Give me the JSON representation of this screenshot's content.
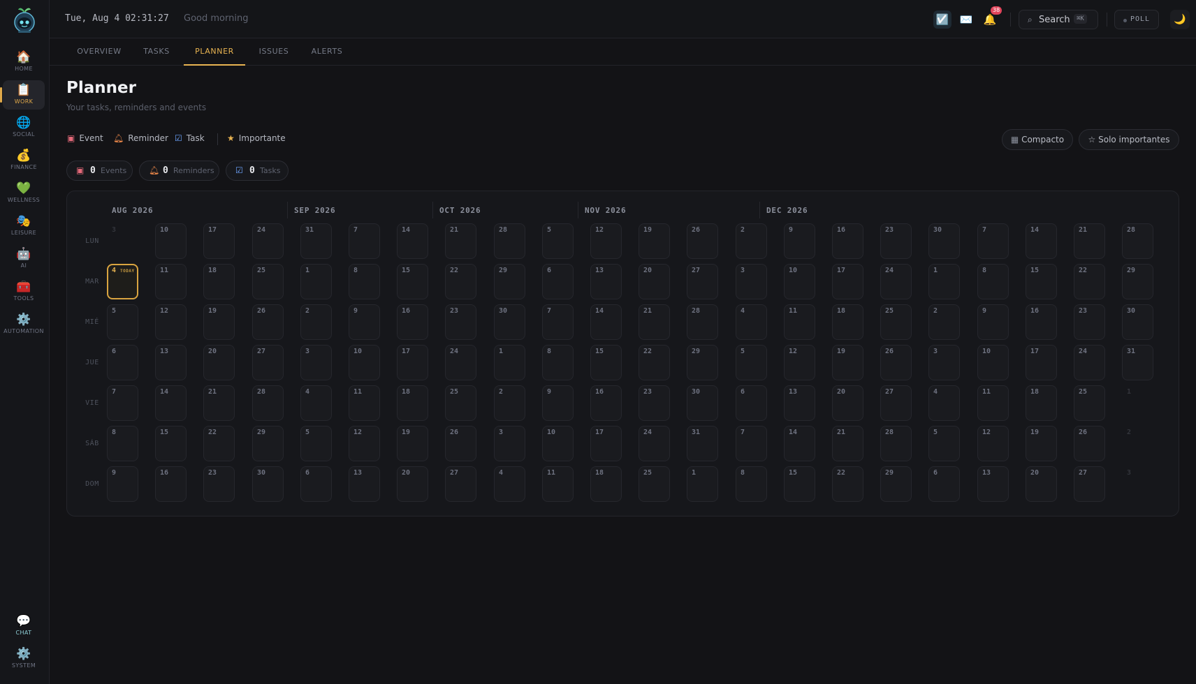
{
  "sidebar": {
    "items": [
      {
        "label": "HOME",
        "icon": "🏠",
        "icon_name": "house-icon"
      },
      {
        "label": "WORK",
        "icon": "📋",
        "icon_name": "clipboard-icon"
      },
      {
        "label": "SOCIAL",
        "icon": "🌐",
        "icon_name": "globe-icon"
      },
      {
        "label": "FINANCE",
        "icon": "💰",
        "icon_name": "money-bag-icon"
      },
      {
        "label": "WELLNESS",
        "icon": "💚",
        "icon_name": "green-heart-icon"
      },
      {
        "label": "LEISURE",
        "icon": "🎭",
        "icon_name": "theater-masks-icon"
      },
      {
        "label": "AI",
        "icon": "🤖",
        "icon_name": "robot-icon"
      },
      {
        "label": "TOOLS",
        "icon": "🧰",
        "icon_name": "toolbox-icon"
      },
      {
        "label": "AUTOMATION",
        "icon": "⚙️",
        "icon_name": "gear-icon"
      }
    ],
    "bottom_items": [
      {
        "label": "CHAT",
        "icon": "💬",
        "icon_name": "speech-bubble-icon"
      },
      {
        "label": "SYSTEM",
        "icon": "⚙️",
        "icon_name": "gear-icon"
      }
    ],
    "active": "WORK"
  },
  "header": {
    "datetime": "Tue, Aug 4 02:31:27",
    "greeting": "Good morning",
    "notifications_count": "38",
    "search_label": "Search",
    "search_shortcut": "⌘K",
    "poll_label": "POLL",
    "icons": {
      "tasks": "☑️",
      "mail": "✉️",
      "bell": "🔔",
      "search": "⌕",
      "theme": "🌙"
    }
  },
  "tabs": [
    "OVERVIEW",
    "TASKS",
    "PLANNER",
    "ISSUES",
    "ALERTS"
  ],
  "active_tab": "PLANNER",
  "page": {
    "title": "Planner",
    "subtitle": "Your tasks, reminders and events"
  },
  "legend": {
    "event": "Event",
    "reminder": "Reminder",
    "task": "Task",
    "important": "Importante"
  },
  "filters": {
    "compact": "Compacto",
    "only_important": "Solo importantes"
  },
  "counters": {
    "events": {
      "count": "0",
      "label": "Events"
    },
    "reminders": {
      "count": "0",
      "label": "Reminders"
    },
    "tasks": {
      "count": "0",
      "label": "Tasks"
    }
  },
  "calendar": {
    "months": [
      "AUG 2026",
      "SEP 2026",
      "OCT 2026",
      "NOV 2026",
      "DEC 2026"
    ],
    "weekdays": [
      "LUN",
      "MAR",
      "MIÉ",
      "JUE",
      "VIE",
      "SÁB",
      "DOM"
    ],
    "today_label": "TODAY",
    "weeks": [
      [
        "3",
        "4",
        "5",
        "6",
        "7",
        "8",
        "9"
      ],
      [
        "10",
        "11",
        "12",
        "13",
        "14",
        "15",
        "16"
      ],
      [
        "17",
        "18",
        "19",
        "20",
        "21",
        "22",
        "23"
      ],
      [
        "24",
        "25",
        "26",
        "27",
        "28",
        "29",
        "30"
      ],
      [
        "31",
        "1",
        "2",
        "3",
        "4",
        "5",
        "6"
      ],
      [
        "7",
        "8",
        "9",
        "10",
        "11",
        "12",
        "13"
      ],
      [
        "14",
        "15",
        "16",
        "17",
        "18",
        "19",
        "20"
      ],
      [
        "21",
        "22",
        "23",
        "24",
        "25",
        "26",
        "27"
      ],
      [
        "28",
        "29",
        "30",
        "1",
        "2",
        "3",
        "4"
      ],
      [
        "5",
        "6",
        "7",
        "8",
        "9",
        "10",
        "11"
      ],
      [
        "12",
        "13",
        "14",
        "15",
        "16",
        "17",
        "18"
      ],
      [
        "19",
        "20",
        "21",
        "22",
        "23",
        "24",
        "25"
      ],
      [
        "26",
        "27",
        "28",
        "29",
        "30",
        "31",
        "1"
      ],
      [
        "2",
        "3",
        "4",
        "5",
        "6",
        "7",
        "8"
      ],
      [
        "9",
        "10",
        "11",
        "12",
        "13",
        "14",
        "15"
      ],
      [
        "16",
        "17",
        "18",
        "19",
        "20",
        "21",
        "22"
      ],
      [
        "23",
        "24",
        "25",
        "26",
        "27",
        "28",
        "29"
      ],
      [
        "30",
        "1",
        "2",
        "3",
        "4",
        "5",
        "6"
      ],
      [
        "7",
        "8",
        "9",
        "10",
        "11",
        "12",
        "13"
      ],
      [
        "14",
        "15",
        "16",
        "17",
        "18",
        "19",
        "20"
      ],
      [
        "21",
        "22",
        "23",
        "24",
        "25",
        "26",
        "27"
      ],
      [
        "28",
        "29",
        "30",
        "31",
        "1",
        "2",
        "3"
      ]
    ]
  }
}
